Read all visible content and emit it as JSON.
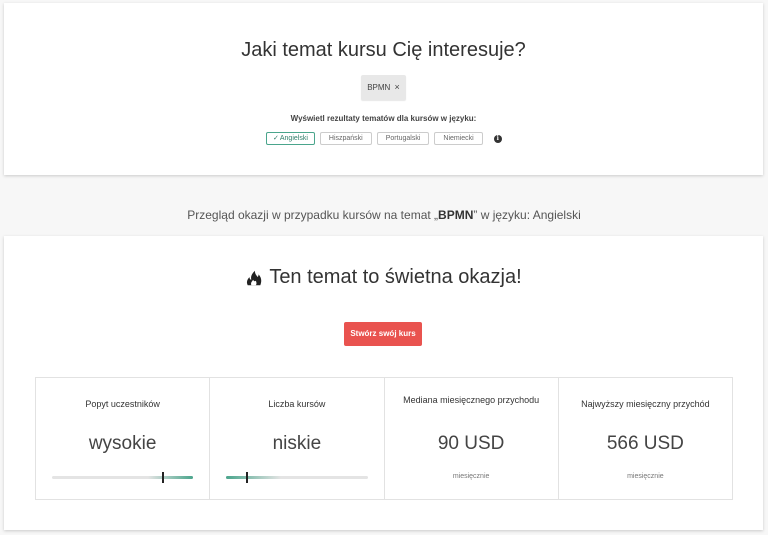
{
  "search": {
    "question": "Jaki temat kursu Cię interesuje?",
    "tag": "BPMN",
    "tag_remove": "×",
    "language_caption": "Wyświetl rezultaty tematów dla kursów w języku:",
    "languages": [
      {
        "label": "Angielski",
        "active": true
      },
      {
        "label": "Hiszpański",
        "active": false
      },
      {
        "label": "Portugalski",
        "active": false
      },
      {
        "label": "Niemiecki",
        "active": false
      }
    ],
    "info_icon": "info-circle-icon"
  },
  "overview": {
    "prefix": "Przegląd okazji w przypadku kursów na temat „",
    "topic": "BPMN",
    "suffix": "” w języku: Angielski"
  },
  "opportunity": {
    "icon": "fire-icon",
    "headline": "Ten temat to świetna okazja!",
    "cta": "Stwórz swój kurs"
  },
  "stats": [
    {
      "label": "Popyt uczestników",
      "value": "wysokie",
      "gauge_level": 0.78
    },
    {
      "label": "Liczba kursów",
      "value": "niskie",
      "gauge_level": 0.14
    },
    {
      "label": "Mediana miesięcznego przychodu",
      "value": "90 USD",
      "sub": "miesięcznie"
    },
    {
      "label": "Najwyższy miesięczny przychód",
      "value": "566 USD",
      "sub": "miesięcznie"
    }
  ],
  "colors": {
    "accent": "#4aa58c",
    "cta": "#e9534f",
    "gauge_track": "#e4e4e4"
  }
}
